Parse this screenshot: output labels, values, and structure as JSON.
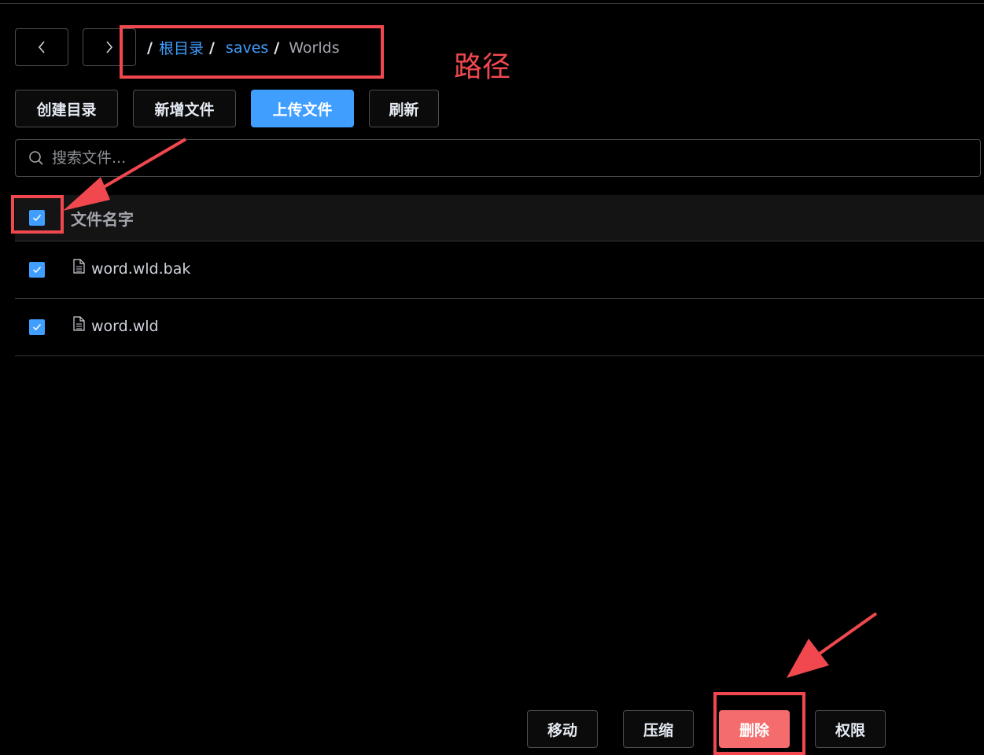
{
  "nav": {
    "back_icon": "chevron-left-icon",
    "forward_icon": "chevron-right-icon"
  },
  "breadcrumb": {
    "root": "根目录",
    "level1": "saves",
    "current": "Worlds",
    "separator": "/"
  },
  "annotation": {
    "path_label": "路径"
  },
  "toolbar": {
    "create_dir": "创建目录",
    "new_file": "新增文件",
    "upload": "上传文件",
    "refresh": "刷新"
  },
  "search": {
    "placeholder": "搜索文件..."
  },
  "table": {
    "header": "文件名字",
    "rows": [
      {
        "name": "word.wld.bak",
        "checked": true
      },
      {
        "name": "word.wld",
        "checked": true
      }
    ]
  },
  "actions": {
    "move": "移动",
    "compress": "压缩",
    "delete": "删除",
    "permission": "权限"
  },
  "colors": {
    "accent": "#409eff",
    "danger": "#f56c6c",
    "annotation": "#f0484e"
  }
}
